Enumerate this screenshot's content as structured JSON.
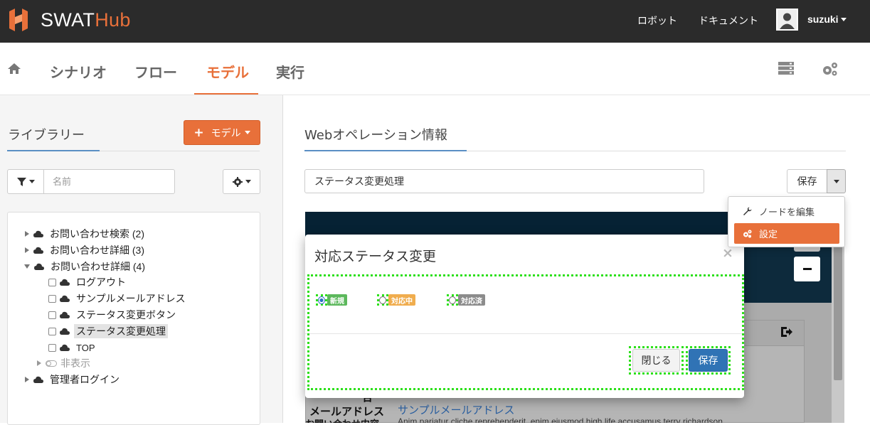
{
  "brand": {
    "part1": "SWAT",
    "part2": "Hub"
  },
  "topnav": {
    "robot": "ロボット",
    "document": "ドキュメント",
    "username": "suzuki"
  },
  "mainnav": {
    "scenario": "シナリオ",
    "flow": "フロー",
    "model": "モデル",
    "run": "実行"
  },
  "library": {
    "title": "ライブラリー",
    "add_model_button": "モデル",
    "name_placeholder": "名前",
    "tree": [
      {
        "label": "お問い合わせ検索 (2)",
        "expanded": false
      },
      {
        "label": "お問い合わせ詳細 (3)",
        "expanded": false
      },
      {
        "label": "お問い合わせ詳細 (4)",
        "expanded": true
      },
      {
        "label": "ログアウト"
      },
      {
        "label": "サンプルメールアドレス"
      },
      {
        "label": "ステータス変更ボタン"
      },
      {
        "label": "ステータス変更処理",
        "selected": true
      },
      {
        "label": "TOP"
      },
      {
        "label": "非表示"
      },
      {
        "label": "管理者ログイン",
        "expanded": false
      }
    ]
  },
  "web_op": {
    "title": "Webオペレーション情報",
    "name_value": "ステータス変更処理",
    "save_button": "保存",
    "dropdown": {
      "edit_node": "ノードを編集",
      "settings": "設定"
    }
  },
  "preview": {
    "email_label": "メールアドレス",
    "email_value": "サンプルメールアドレス",
    "lorem_text": "Anim pariatur cliche reprehenderit, enim eiusmod high life accusamus terry richardson",
    "partial_label": "合",
    "partial_label2": "お問い合わせ内容"
  },
  "modal": {
    "title": "対応ステータス変更",
    "close_symbol": "×",
    "options": [
      {
        "label": "新規",
        "color": "#5cb85c",
        "selected": true
      },
      {
        "label": "対応中",
        "color": "#f0ad4e",
        "selected": false
      },
      {
        "label": "対応済",
        "color": "#8c8c8c",
        "selected": false
      }
    ],
    "close_button": "閉じる",
    "save_button": "保存"
  },
  "colors": {
    "accent": "#e8703a",
    "topbar": "#2b2b2b",
    "primary": "#3073b5",
    "highlight": "#2de01a"
  }
}
